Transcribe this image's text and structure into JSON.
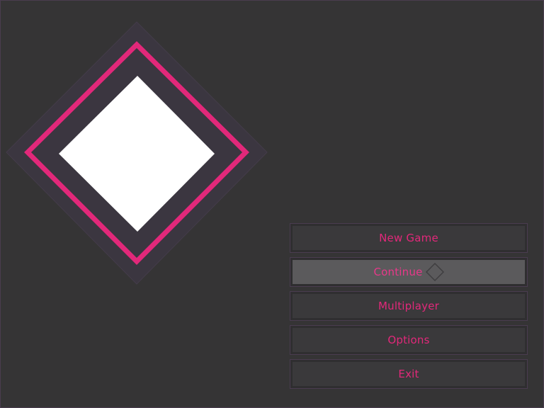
{
  "colors": {
    "background": "#353435",
    "accent": "#e2287a",
    "logo_outer": "#3b3640",
    "logo_fill": "#ffffff",
    "button_bg": "#3a393b",
    "button_selected_bg": "#5b5a5c"
  },
  "logo": {
    "icon": "diamond-logo-icon"
  },
  "menu": {
    "selected_index": 1,
    "items": [
      {
        "label": "New Game"
      },
      {
        "label": "Continue"
      },
      {
        "label": "Multiplayer"
      },
      {
        "label": "Options"
      },
      {
        "label": "Exit"
      }
    ],
    "cursor_icon": "diamond-cursor-icon"
  }
}
